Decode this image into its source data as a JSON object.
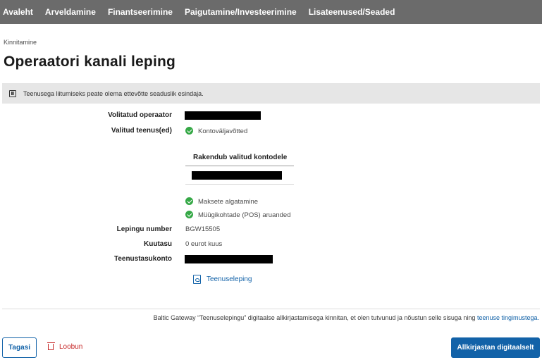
{
  "nav": {
    "items": [
      "Avaleht",
      "Arveldamine",
      "Finantseerimine",
      "Paigutamine/Investeerimine",
      "Lisateenused/Seaded"
    ]
  },
  "breadcrumb": "Kinnitamine",
  "page_title": "Operaatori kanali leping",
  "info_message": "Teenusega liitumiseks peate olema ettevõtte seaduslik esindaja.",
  "details": {
    "operator_label": "Volitatud operaator",
    "services_label": "Valitud teenus(ed)",
    "service_statement": "Kontoväljavõtted",
    "accounts_header": "Rakendub valitud kontodele",
    "service_payment": "Maksete algatamine",
    "service_pos": "Müügikohtade (POS) aruanded",
    "contract_number_label": "Lepingu number",
    "contract_number": "BGW15505",
    "monthly_fee_label": "Kuutasu",
    "monthly_fee": "0 eurot kuus",
    "fee_account_label": "Teenustasukonto"
  },
  "document_link": "Teenuseleping",
  "consent": {
    "text": "Baltic Gateway “Teenuselepingu” digitaalse allkirjastamisega kinnitan, et olen tutvunud ja nõustun selle sisuga ning",
    "link": "teenuse tingimustega."
  },
  "buttons": {
    "back": "Tagasi",
    "cancel": "Loobun",
    "sign": "Allkirjastan digitaalselt"
  },
  "colors": {
    "nav_bg": "#6b6b6b",
    "primary": "#1262a8",
    "success": "#35a846",
    "danger": "#c62828",
    "info_bg": "#e6e6e6"
  }
}
